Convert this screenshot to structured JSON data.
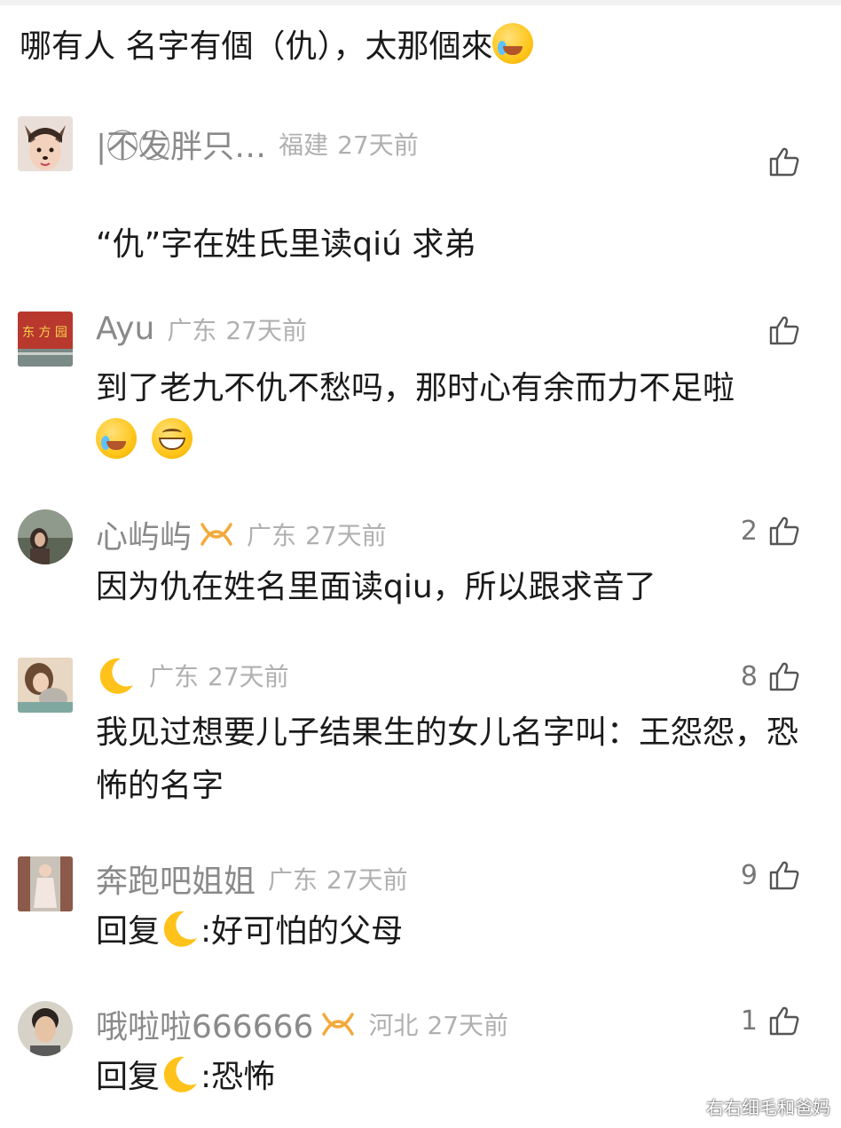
{
  "post": {
    "text": "哪有人 名字有個（仇），太那個來",
    "emoji": "laugh-cry-emoji"
  },
  "comments": [
    {
      "username": "|不⃝发⃝胖只…",
      "region": "福建",
      "time": "27天前",
      "likes": "",
      "text": "“仇”字在姓氏里读qiú  求弟",
      "avatar": "dog-filter-girl-avatar"
    },
    {
      "username": "Ayu",
      "region": "广东",
      "time": "27天前",
      "likes": "",
      "text": "到了老九不仇不愁吗，那时心有余而力不足啦",
      "emojis": [
        "laugh-cry-emoji",
        "grin-emoji"
      ],
      "avatar": "red-banner-avatar"
    },
    {
      "username": "心屿屿",
      "region": "广东",
      "time": "27天前",
      "likes": "2",
      "text": "因为仇在姓名里面读qiu，所以跟求音了",
      "badge": "vip-loop-badge",
      "avatar": "woman-landscape-avatar"
    },
    {
      "username": "",
      "region": "广东",
      "time": "27天前",
      "likes": "8",
      "text": "我见过想要儿子结果生的女儿名字叫：王怨怨，恐怖的名字",
      "name_icon": "crescent-moon-icon",
      "avatar": "girl-with-cat-avatar"
    },
    {
      "username": "奔跑吧姐姐",
      "region": "广东",
      "time": "27天前",
      "likes": "9",
      "reply_prefix": "回复",
      "reply_suffix": ":好可怕的父母",
      "avatar": "woman-street-avatar"
    },
    {
      "username": "哦啦啦666666",
      "region": "河北",
      "time": "27天前",
      "likes": "1",
      "reply_prefix": "回复",
      "reply_suffix": ":恐怖",
      "badge": "vip-loop-badge",
      "avatar": "man-portrait-avatar"
    }
  ],
  "watermark": "右右细毛和爸妈",
  "colors": {
    "text": "#1a1a1a",
    "username": "#8a8a8a",
    "meta": "#b0b0b0",
    "badge": "#f2a93b",
    "moon": "#ffc21a"
  }
}
